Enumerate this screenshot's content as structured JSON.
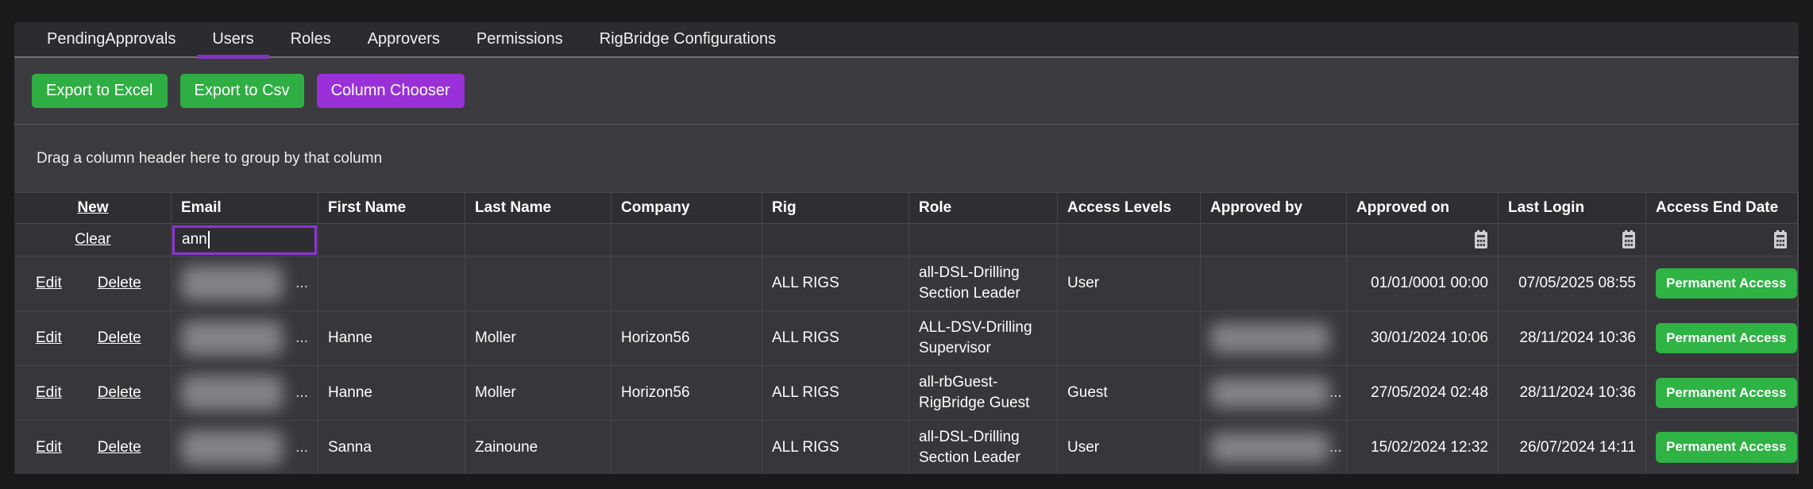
{
  "colors": {
    "accent_purple": "#9a31d8",
    "tab_underline_purple": "#8233c4",
    "filter_focus_purple": "#8d35d6",
    "button_green": "#2fae43",
    "badge_green": "#2fb344"
  },
  "tabs": {
    "active_index": 1,
    "items": [
      {
        "label": "PendingApprovals"
      },
      {
        "label": "Users"
      },
      {
        "label": "Roles"
      },
      {
        "label": "Approvers"
      },
      {
        "label": "Permissions"
      },
      {
        "label": "RigBridge Configurations"
      }
    ]
  },
  "toolbar": {
    "export_excel_label": "Export to Excel",
    "export_csv_label": "Export to Csv",
    "column_chooser_label": "Column Chooser"
  },
  "group_panel": {
    "text": "Drag a column header here to group by that column"
  },
  "grid": {
    "command": {
      "new": "New",
      "clear": "Clear",
      "edit": "Edit",
      "delete": "Delete"
    },
    "columns": [
      {
        "key": "email",
        "label": "Email"
      },
      {
        "key": "first_name",
        "label": "First Name"
      },
      {
        "key": "last_name",
        "label": "Last Name"
      },
      {
        "key": "company",
        "label": "Company"
      },
      {
        "key": "rig",
        "label": "Rig"
      },
      {
        "key": "role",
        "label": "Role"
      },
      {
        "key": "access_levels",
        "label": "Access Levels"
      },
      {
        "key": "approved_by",
        "label": "Approved by"
      },
      {
        "key": "approved_on",
        "label": "Approved on"
      },
      {
        "key": "last_login",
        "label": "Last Login"
      },
      {
        "key": "access_end_date",
        "label": "Access End Date"
      }
    ],
    "filter_row": {
      "email_value": "ann",
      "calendar_columns": [
        "approved_on",
        "last_login",
        "access_end_date"
      ]
    },
    "rows": [
      {
        "email": {
          "redacted": true,
          "ellipsis": true
        },
        "first_name": "",
        "last_name": "",
        "company": "",
        "rig": "ALL RIGS",
        "role": "all-DSL-Drilling Section Leader",
        "access_levels": "User",
        "approved_by": "",
        "approved_on": "01/01/0001 00:00",
        "last_login": "07/05/2025 08:55",
        "access_end_date": {
          "badge": "Permanent Access"
        }
      },
      {
        "email": {
          "redacted": true,
          "ellipsis": true
        },
        "first_name": "Hanne",
        "last_name": "Moller",
        "company": "Horizon56",
        "rig": "ALL RIGS",
        "role": "ALL-DSV-Drilling Supervisor",
        "access_levels": "",
        "approved_by": {
          "redacted": true,
          "ellipsis": false
        },
        "approved_on": "30/01/2024 10:06",
        "last_login": "28/11/2024 10:36",
        "access_end_date": {
          "badge": "Permanent Access"
        }
      },
      {
        "email": {
          "redacted": true,
          "ellipsis": true
        },
        "first_name": "Hanne",
        "last_name": "Moller",
        "company": "Horizon56",
        "rig": "ALL RIGS",
        "role": "all-rbGuest-RigBridge Guest",
        "access_levels": "Guest",
        "approved_by": {
          "redacted": true,
          "ellipsis": true
        },
        "approved_on": "27/05/2024 02:48",
        "last_login": "28/11/2024 10:36",
        "access_end_date": {
          "badge": "Permanent Access"
        }
      },
      {
        "email": {
          "redacted": true,
          "ellipsis": true
        },
        "first_name": "Sanna",
        "last_name": "Zainoune",
        "company": "",
        "rig": "ALL RIGS",
        "role": "all-DSL-Drilling Section Leader",
        "access_levels": "User",
        "approved_by": {
          "redacted": true,
          "ellipsis": true
        },
        "approved_on": "15/02/2024 12:32",
        "last_login": "26/07/2024 14:11",
        "access_end_date": {
          "badge": "Permanent Access"
        }
      }
    ]
  }
}
